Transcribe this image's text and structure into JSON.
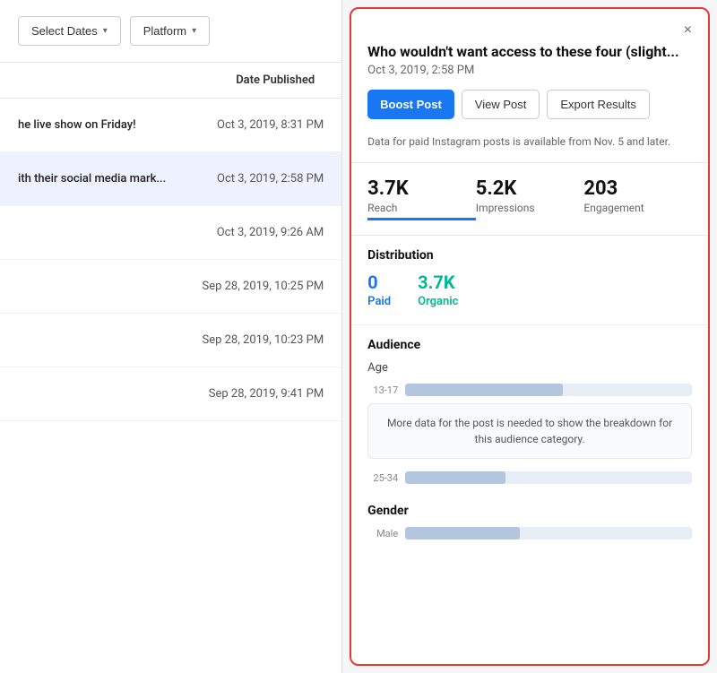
{
  "toolbar": {
    "select_dates_label": "Select Dates",
    "platform_label": "Platform"
  },
  "table": {
    "header_label": "Date Published",
    "rows": [
      {
        "title": "he live show on Friday!",
        "date": "Oct 3, 2019, 8:31 PM",
        "highlighted": false
      },
      {
        "title": "ith their social media mark...",
        "date": "Oct 3, 2019, 2:58 PM",
        "highlighted": true
      },
      {
        "title": "",
        "date": "Oct 3, 2019, 9:26 AM",
        "highlighted": false
      },
      {
        "title": "",
        "date": "Sep 28, 2019, 10:25 PM",
        "highlighted": false
      },
      {
        "title": "",
        "date": "Sep 28, 2019, 10:23 PM",
        "highlighted": false
      },
      {
        "title": "",
        "date": "Sep 28, 2019, 9:41 PM",
        "highlighted": false
      }
    ]
  },
  "detail_card": {
    "title": "Who wouldn't want access to these four (slight...",
    "date": "Oct 3, 2019, 2:58 PM",
    "boost_label": "Boost Post",
    "view_post_label": "View Post",
    "export_label": "Export Results",
    "notice": "Data for paid Instagram posts is available from Nov. 5 and later.",
    "close_label": "×",
    "stats": [
      {
        "value": "3.7K",
        "label": "Reach",
        "active": true
      },
      {
        "value": "5.2K",
        "label": "Impressions",
        "active": false
      },
      {
        "value": "203",
        "label": "Engagement",
        "active": false
      }
    ],
    "distribution": {
      "title": "Distribution",
      "paid_value": "0",
      "paid_label": "Paid",
      "organic_value": "3.7K",
      "organic_label": "Organic"
    },
    "audience": {
      "title": "Audience",
      "age_title": "Age",
      "age_bars": [
        {
          "label": "13-17",
          "fill_pct": 55
        },
        {
          "label": "25-34",
          "fill_pct": 35
        }
      ],
      "more_data_notice": "More data for the post is needed to show the breakdown for this audience category.",
      "gender_title": "Gender",
      "gender_bars": [
        {
          "label": "Male",
          "fill_pct": 40
        }
      ]
    }
  },
  "icons": {
    "chevron": "▾",
    "close": "×"
  }
}
